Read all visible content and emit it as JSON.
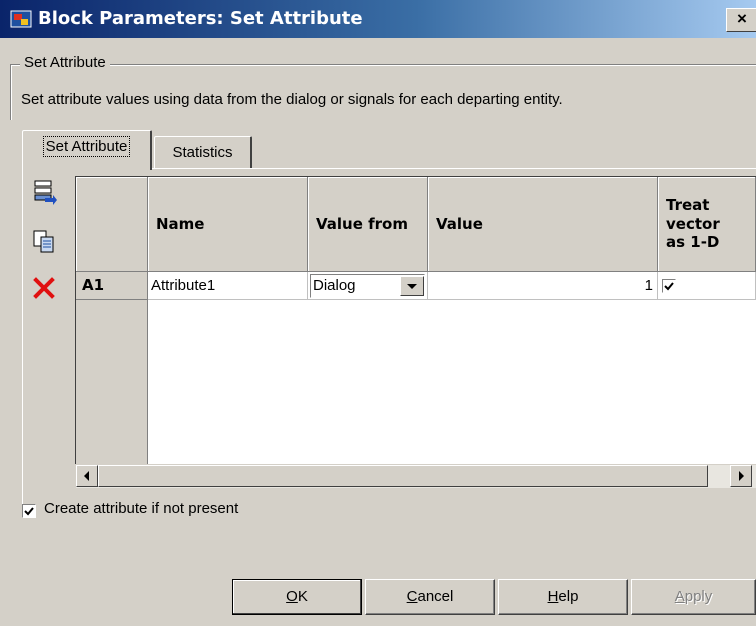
{
  "window": {
    "title": "Block Parameters: Set Attribute",
    "close_glyph": "×"
  },
  "groupbox": {
    "title": "Set Attribute",
    "description": "Set attribute values using data from the dialog or signals for each departing entity."
  },
  "tabs": [
    {
      "label": "Set Attribute",
      "selected": true
    },
    {
      "label": "Statistics",
      "selected": false
    }
  ],
  "toolbar": {
    "icons": [
      "add-row-icon",
      "copy-row-icon",
      "delete-row-icon"
    ]
  },
  "table": {
    "columns": [
      "Name",
      "Value from",
      "Value",
      "Treat vector as 1-D"
    ],
    "treat_header_lines": [
      "Treat",
      "vector",
      "as 1-D"
    ],
    "rows": [
      {
        "header": "A1",
        "name": "Attribute1",
        "value_from": "Dialog",
        "value": "1",
        "treat_vector": true
      }
    ]
  },
  "create_attribute": {
    "label": "Create attribute if not present",
    "checked": true
  },
  "buttons": {
    "ok": {
      "mnemonic": "O",
      "rest": "K"
    },
    "cancel": {
      "mnemonic": "C",
      "rest": "ancel"
    },
    "help": {
      "mnemonic": "H",
      "rest": "elp"
    },
    "apply": {
      "mnemonic": "A",
      "rest": "pply",
      "enabled": false
    }
  },
  "colors": {
    "face": "#d4d0c8",
    "title_start": "#0a246a",
    "title_end": "#a6caf0",
    "delete_red": "#e01010"
  }
}
